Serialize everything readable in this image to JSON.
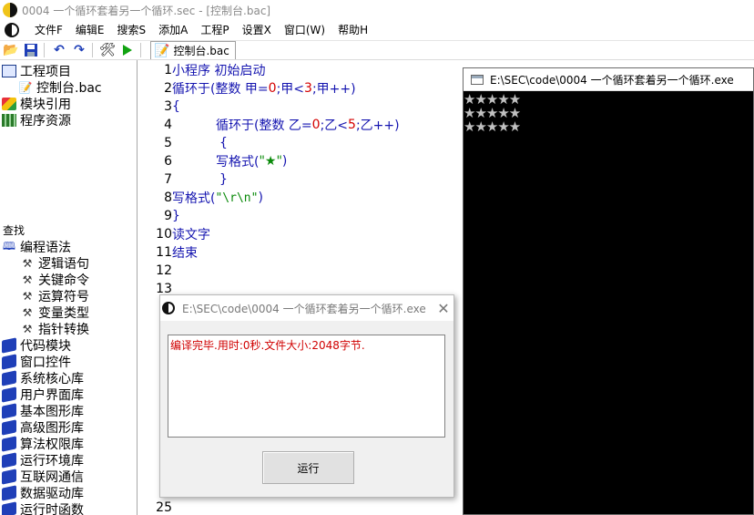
{
  "window": {
    "title": "0004 一个循环套着另一个循环.sec - [控制台.bac]"
  },
  "menu": [
    "文件F",
    "编辑E",
    "搜索S",
    "添加A",
    "工程P",
    "设置X",
    "窗口(W)",
    "帮助H"
  ],
  "toolbar": {
    "tab_label": "控制台.bac"
  },
  "tree": {
    "project": "工程项目",
    "project_file": "控制台.bac",
    "module_ref": "模块引用",
    "resources": "程序资源",
    "search_label": "查找",
    "grammar": "编程语法",
    "grammar_children": [
      "逻辑语句",
      "关键命令",
      "运算符号",
      "变量类型",
      "指针转换"
    ],
    "libraries": [
      "代码模块",
      "窗口控件",
      "系统核心库",
      "用户界面库",
      "基本图形库",
      "高级图形库",
      "算法权限库",
      "运行环境库",
      "互联网通信",
      "数据驱动库",
      "运行时函数"
    ]
  },
  "editor": {
    "line_numbers": [
      "1",
      "2",
      "3",
      "4",
      "5",
      "6",
      "7",
      "8",
      "9",
      "10",
      "11",
      "12",
      "13",
      "25"
    ],
    "lines": {
      "l1": "小程序 初始启动",
      "l2_kw": "循环于(整数 甲=",
      "l2_n1": "0",
      "l2_mid": ";甲<",
      "l2_n2": "3",
      "l2_end": ";甲++)",
      "l3": "{",
      "l4_kw": "循环于(整数 乙=",
      "l4_n1": "0",
      "l4_mid": ";乙<",
      "l4_n2": "5",
      "l4_end": ";乙++)",
      "l5": "{",
      "l6_kw": "写格式(",
      "l6_str": "\"★\"",
      "l6_end": ")",
      "l7": "}",
      "l8_kw": "写格式(",
      "l8_str": "\"\\r\\n\"",
      "l8_end": ")",
      "l9": "}",
      "l10": "读文字",
      "l11": "结束"
    }
  },
  "console": {
    "title": "E:\\SEC\\code\\0004 一个循环套着另一个循环.exe",
    "output_rows": [
      "★★★★★",
      "★★★★★",
      "★★★★★"
    ]
  },
  "dialog": {
    "title": "E:\\SEC\\code\\0004 一个循环套着另一个循环.exe",
    "message": "编译完毕.用时:0秒.文件大小:2048字节.",
    "run_button": "运行",
    "close_glyph": "✕"
  }
}
